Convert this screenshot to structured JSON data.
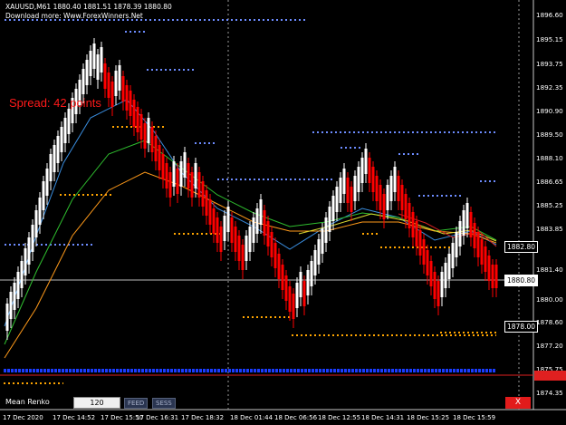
{
  "header": {
    "line1": "XAUUSD,M61  1880.40 1881.51 1878.39 1880.80",
    "line2": "Download more: Www.ForexWinners.Net"
  },
  "spread_text": "Spread: 42 points",
  "price_axis": {
    "labels": [
      "1896.60",
      "1895.15",
      "1893.75",
      "1892.35",
      "1890.90",
      "1889.50",
      "1888.10",
      "1886.65",
      "1885.25",
      "1883.85",
      "1881.40",
      "1880.00",
      "1878.60",
      "1877.20",
      "1875.75",
      "1874.35"
    ],
    "tag_current": "1882.80",
    "tag_bid": "1880.80",
    "tag_low": "1878.00",
    "tag_red": "1875.55"
  },
  "time_axis": {
    "labels": [
      "17 Dec 2020",
      "17 Dec 14:52",
      "17 Dec 15:50",
      "17 Dec 16:31",
      "17 Dec 18:32",
      "18 Dec 01:44",
      "18 Dec 06:56",
      "18 Dec 12:55",
      "18 Dec 14:31",
      "18 Dec 15:25",
      "18 Dec 15:59"
    ]
  },
  "toolbar": {
    "label": "Mean Renko",
    "value": "120",
    "feed_button": "FEED",
    "sess_button": "SESS",
    "close_button": "X"
  },
  "colors": {
    "background": "#000000",
    "bull_candle": "#ffffff",
    "bear_candle": "#ff0000",
    "dot_resistance": "#6d8cff",
    "dot_support": "#ffa500",
    "ma_blue": "#3a8ee0",
    "ma_green": "#2fbf2f",
    "ma_orange": "#ff9a1a",
    "ma_yellow": "#d8d830",
    "ma_red": "#d02020",
    "ask_line": "#e02020"
  }
}
